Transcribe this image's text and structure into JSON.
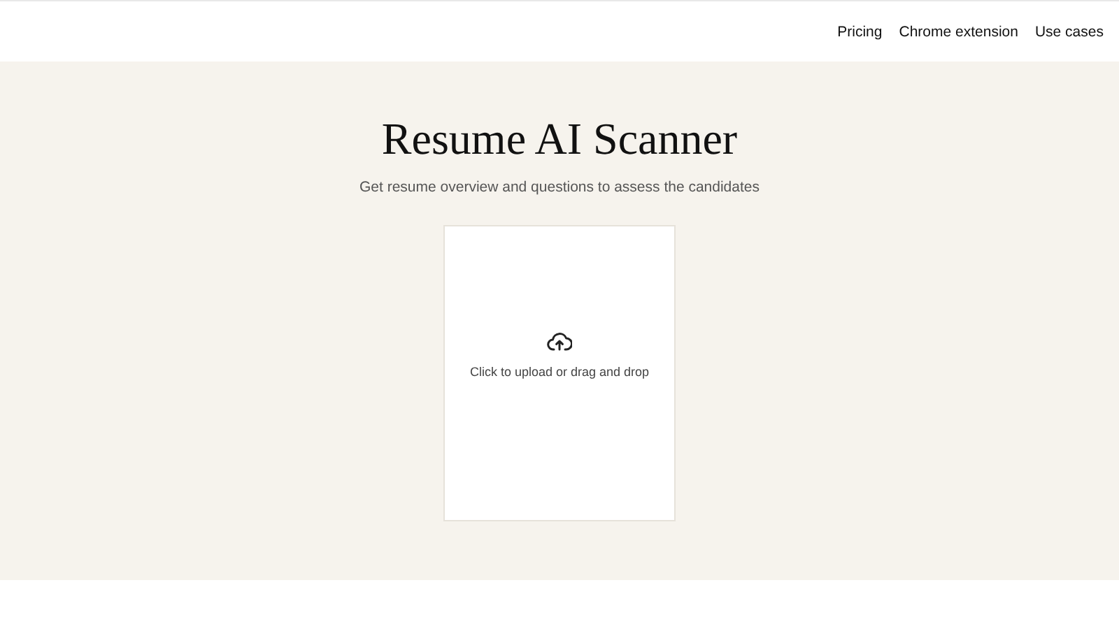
{
  "nav": {
    "links": [
      "Pricing",
      "Chrome extension",
      "Use cases"
    ]
  },
  "hero": {
    "title": "Resume AI Scanner",
    "subtitle": "Get resume overview and questions to assess the candidates"
  },
  "upload": {
    "prompt": "Click to upload or drag and drop"
  }
}
